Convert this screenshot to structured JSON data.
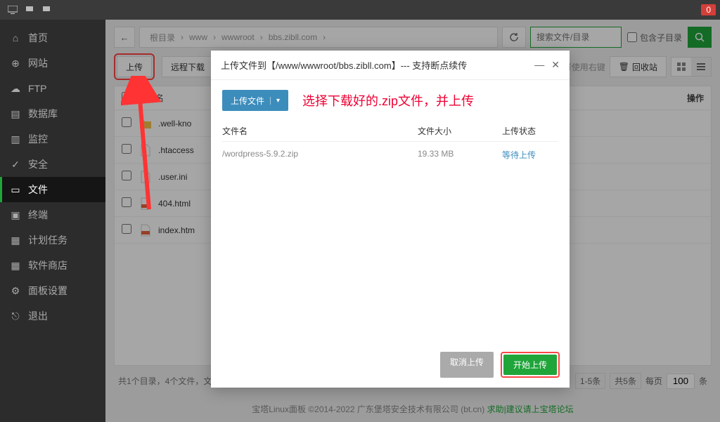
{
  "titlebar": {
    "notification_count": "0"
  },
  "sidebar": {
    "items": [
      {
        "label": "首页"
      },
      {
        "label": "网站"
      },
      {
        "label": "FTP"
      },
      {
        "label": "数据库"
      },
      {
        "label": "监控"
      },
      {
        "label": "安全"
      },
      {
        "label": "文件"
      },
      {
        "label": "终端"
      },
      {
        "label": "计划任务"
      },
      {
        "label": "软件商店"
      },
      {
        "label": "面板设置"
      },
      {
        "label": "退出"
      }
    ]
  },
  "path": {
    "root": "根目录",
    "seg1": "www",
    "seg2": "wwwroot",
    "seg3": "bbs.zibll.com"
  },
  "search": {
    "placeholder": "搜索文件/目录",
    "include_sub": "包含子目录"
  },
  "toolbar": {
    "upload": "上传",
    "remote_download": "远程下载",
    "right_click_hint": "可使用右键",
    "recycle": "回收站"
  },
  "table": {
    "head_name": "文件名",
    "head_action": "操作",
    "rows": [
      {
        "name": ".well-kno",
        "type": "folder"
      },
      {
        "name": ".htaccess",
        "type": "file"
      },
      {
        "name": ".user.ini",
        "type": "file"
      },
      {
        "name": "404.html",
        "type": "html"
      },
      {
        "name": "index.htm",
        "type": "html"
      }
    ]
  },
  "infobar": {
    "summary": "共1个目录，4个文件，文",
    "range": "1-5条",
    "total": "共5条",
    "per_page_label": "每页",
    "per_page_value": "100",
    "per_page_unit": "条"
  },
  "footer": {
    "text": "宝塔Linux面板 ©2014-2022 广东堡塔安全技术有限公司 (bt.cn)   ",
    "link": "求助|建议请上宝塔论坛"
  },
  "modal": {
    "title": "上传文件到【/www/wwwroot/bbs.zibll.com】--- 支持断点续传",
    "upload_btn": "上传文件",
    "annotation": "选择下载好的.zip文件，并上传",
    "head_name": "文件名",
    "head_size": "文件大小",
    "head_status": "上传状态",
    "row": {
      "name": "/wordpress-5.9.2.zip",
      "size": "19.33 MB",
      "status": "等待上传"
    },
    "cancel": "取消上传",
    "start": "开始上传"
  }
}
